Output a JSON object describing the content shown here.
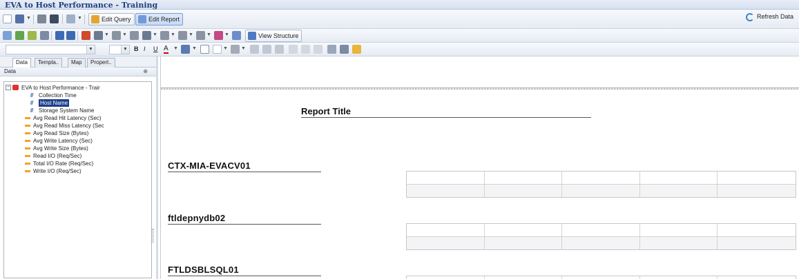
{
  "window": {
    "title": "EVA to Host Performance - Training"
  },
  "toolbar": {
    "edit_query_label": "Edit Query",
    "edit_report_label": "Edit Report",
    "refresh_label": "Refresh Data",
    "view_structure_label": "View Structure",
    "font_bold": "B",
    "font_italic": "I",
    "font_underline": "U",
    "font_color_glyph": "A"
  },
  "left_panel": {
    "tabs": [
      {
        "label": "Data"
      },
      {
        "label": "Templa.."
      },
      {
        "label": "Map"
      },
      {
        "label": "Propert.."
      }
    ],
    "panel_header": "Data",
    "tree": {
      "root_label": "EVA to Host Performance - Trair",
      "items": [
        {
          "label": "Collection Time",
          "kind": "dimension"
        },
        {
          "label": "Host Name",
          "kind": "dimension",
          "selected": true
        },
        {
          "label": "Storage System Name",
          "kind": "dimension"
        },
        {
          "label": "Avg Read Hit Latency (Sec)",
          "kind": "measure"
        },
        {
          "label": "Avg Read Miss Latency (Sec",
          "kind": "measure"
        },
        {
          "label": "Avg Read Size (Bytes)",
          "kind": "measure"
        },
        {
          "label": "Avg Write Latency (Sec)",
          "kind": "measure"
        },
        {
          "label": "Avg Write Size (Bytes)",
          "kind": "measure"
        },
        {
          "label": "Read I/O (Req/Sec)",
          "kind": "measure"
        },
        {
          "label": "Total I/O Rate (Req/Sec)",
          "kind": "measure"
        },
        {
          "label": "Write I/O (Req/Sec)",
          "kind": "measure"
        }
      ]
    }
  },
  "report": {
    "title": "Report Title",
    "sections": [
      {
        "host": "CTX-MIA-EVACV01"
      },
      {
        "host": "ftldepnydb02"
      },
      {
        "host": "FTLDSBLSQL01"
      }
    ]
  },
  "colors": {
    "title_text": "#1f3f7a",
    "selection": "#1c3f8c",
    "measure_icon": "#f2a227",
    "dimension_icon": "#8da2c4"
  }
}
